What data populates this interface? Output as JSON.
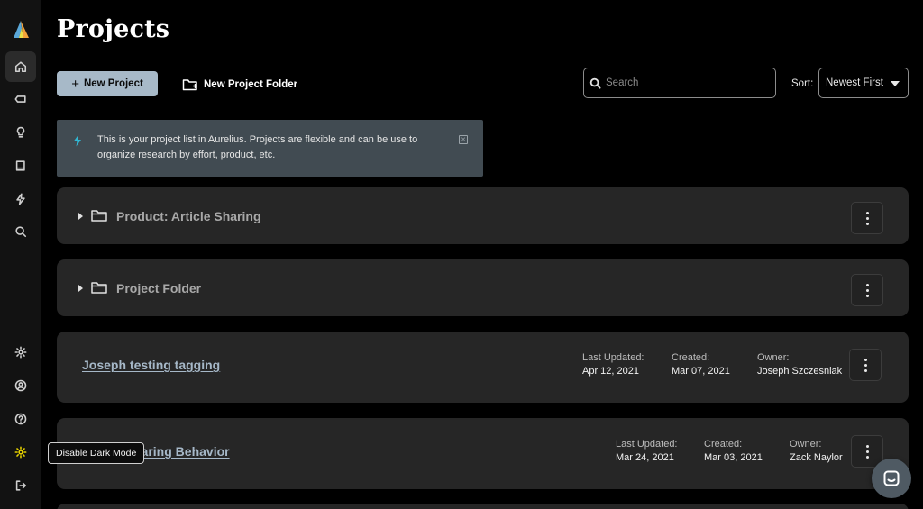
{
  "header": {
    "title": "Projects"
  },
  "toolbar": {
    "new_project_label": "New Project",
    "new_folder_label": "New Project Folder",
    "search_placeholder": "Search",
    "sort_label": "Sort:",
    "sort_value": "Newest First"
  },
  "banner": {
    "message": "This is your project list in Aurelius. Projects are flexible and can be use to organize research by effort, product, etc.",
    "close_icon": "close-icon"
  },
  "folders": [
    {
      "name": "Product: Article Sharing"
    },
    {
      "name": "Project Folder"
    }
  ],
  "projects": [
    {
      "name": "Joseph testing tagging",
      "last_updated_label": "Last Updated:",
      "last_updated": "Apr 12, 2021",
      "created_label": "Created:",
      "created": "Mar 07, 2021",
      "owner_label": "Owner:",
      "owner": "Joseph Szczesniak"
    },
    {
      "name": "haring Behavior",
      "last_updated_label": "Last Updated:",
      "last_updated": "Mar 24, 2021",
      "created_label": "Created:",
      "created": "Mar 03, 2021",
      "owner_label": "Owner:",
      "owner": "Zack Naylor"
    }
  ],
  "sidebar": {
    "items": [
      "home-icon",
      "tag-icon",
      "lightbulb-icon",
      "book-icon",
      "bolt-icon",
      "search-icon",
      "settings-icon",
      "user-icon",
      "help-icon",
      "dark-mode-icon",
      "logout-icon"
    ],
    "tooltip": "Disable Dark Mode",
    "accent_color": "#e5d000"
  },
  "colors": {
    "primary_button": "#a7b9c8",
    "banner_bg": "#414b52",
    "row_bg": "#262626",
    "link": "#a6b8c8"
  }
}
